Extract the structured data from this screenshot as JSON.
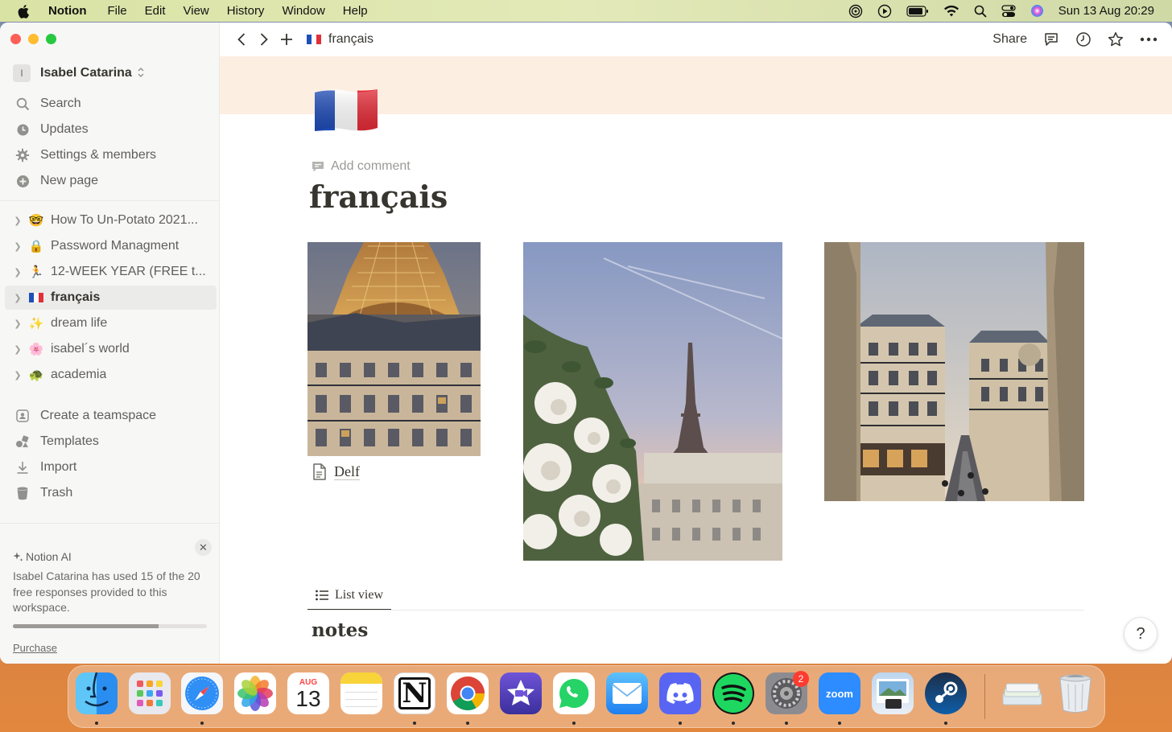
{
  "menubar": {
    "app": "Notion",
    "menus": [
      "File",
      "Edit",
      "View",
      "History",
      "Window",
      "Help"
    ],
    "clock": "Sun 13 Aug  20:29"
  },
  "sidebar": {
    "workspace_initial": "I",
    "workspace_name": "Isabel Catarina",
    "nav": [
      {
        "label": "Search",
        "icon": "search-icon"
      },
      {
        "label": "Updates",
        "icon": "clock-icon"
      },
      {
        "label": "Settings & members",
        "icon": "gear-icon"
      },
      {
        "label": "New page",
        "icon": "plus-circle-icon"
      }
    ],
    "pages": [
      {
        "emoji": "🤓",
        "label": "How To Un-Potato 2021..."
      },
      {
        "emoji": "🔒",
        "label": "Password Managment"
      },
      {
        "emoji": "🏃",
        "label": "12-WEEK YEAR (FREE t..."
      },
      {
        "emoji": "🇫🇷",
        "label": "français",
        "active": true
      },
      {
        "emoji": "✨",
        "label": "dream life"
      },
      {
        "emoji": "🌸",
        "label": "isabel´s world"
      },
      {
        "emoji": "🐢",
        "label": "academia"
      }
    ],
    "tools": [
      {
        "label": "Create a teamspace",
        "icon": "teamspace-icon"
      },
      {
        "label": "Templates",
        "icon": "templates-icon"
      },
      {
        "label": "Import",
        "icon": "import-icon"
      },
      {
        "label": "Trash",
        "icon": "trash-icon"
      }
    ],
    "ai": {
      "title": "Notion AI",
      "text": "Isabel Catarina has used 15 of the 20 free responses provided to this workspace.",
      "used_fraction": 0.75,
      "link": "Purchase"
    }
  },
  "topbar": {
    "breadcrumb_emoji": "🇫🇷",
    "breadcrumb": "français",
    "share": "Share"
  },
  "page": {
    "add_comment": "Add comment",
    "title": "français",
    "file_link": "Delf",
    "view_tab": "List view",
    "section_title": "notes",
    "help": "?"
  },
  "dock": {
    "calendar_month": "AUG",
    "calendar_day": "13",
    "zoom_label": "zoom",
    "settings_badge": "2",
    "notion_letter": "N"
  },
  "colors": {
    "cover": "#fdeee2",
    "sidebar_bg": "#f7f7f5",
    "text": "#37352f"
  }
}
